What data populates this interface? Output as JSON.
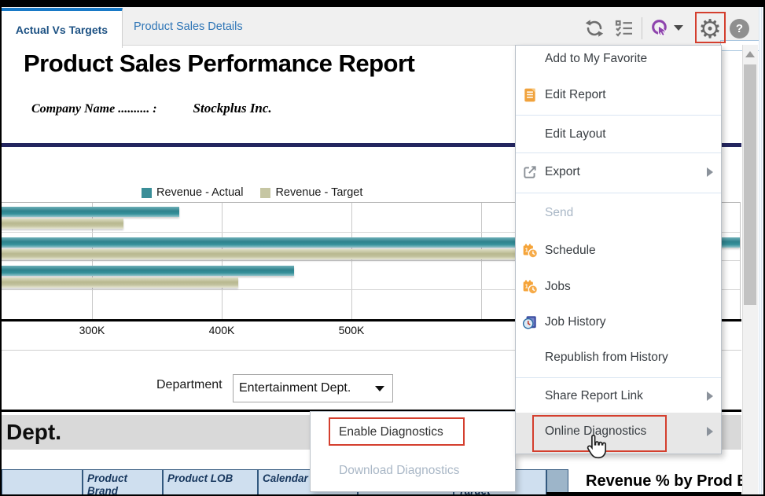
{
  "window": {
    "tabs": [
      {
        "label": "Actual Vs Targets",
        "active": true
      },
      {
        "label": "Product Sales Details",
        "active": false
      }
    ],
    "toolbar": {
      "icons": [
        "refresh-icon",
        "checklist-icon",
        "guided-nav-icon",
        "dropdown-caret-icon",
        "gear-icon",
        "help-icon"
      ],
      "help_glyph": "?"
    }
  },
  "report": {
    "title": "Product Sales Performance Report",
    "company_label": "Company Name .......... :",
    "company_value": "Stockplus Inc."
  },
  "chart_data": {
    "type": "bar",
    "orientation": "horizontal",
    "title": "",
    "xlabel": "",
    "ylabel": "",
    "legend_position": "top",
    "grid": true,
    "legend": [
      {
        "name": "Revenue - Actual",
        "color": "#3a8e98"
      },
      {
        "name": "Revenue - Target",
        "color": "#c6c6a3"
      }
    ],
    "categories": [
      "",
      "",
      ""
    ],
    "series": [
      {
        "name": "Revenue - Actual",
        "values_k": [
          367,
          800,
          456
        ]
      },
      {
        "name": "Revenue - Target",
        "values_k": [
          324,
          757,
          413
        ]
      }
    ],
    "x_ticks": [
      {
        "label": "300K",
        "value_k": 300
      },
      {
        "label": "400K",
        "value_k": 400
      },
      {
        "label": "500K",
        "value_k": 500
      },
      {
        "label": "",
        "value_k": 600
      }
    ],
    "xlim_k": [
      229,
      800
    ]
  },
  "filters": {
    "department_label": "Department",
    "department_value": "Entertainment Dept."
  },
  "menu": {
    "items": [
      {
        "label": "Add to My Favorite"
      },
      {
        "label": "Edit Report",
        "icon": "edit-report-icon"
      },
      {
        "sep": true
      },
      {
        "label": "Edit Layout"
      },
      {
        "sep": true
      },
      {
        "label": "Export",
        "icon": "export-icon",
        "submenu": true
      },
      {
        "sep": true
      },
      {
        "label": "Send",
        "disabled": true
      },
      {
        "label": "Schedule",
        "icon": "schedule-icon"
      },
      {
        "label": "Jobs",
        "icon": "jobs-icon"
      },
      {
        "label": "Job History",
        "icon": "job-history-icon"
      },
      {
        "label": "Republish from History"
      },
      {
        "sep": true
      },
      {
        "label": "Share Report Link",
        "submenu": true
      },
      {
        "label": "Online Diagnostics",
        "submenu": true,
        "highlighted": true
      }
    ]
  },
  "submenu": {
    "items": [
      {
        "label": "Enable Diagnostics"
      },
      {
        "label": "Download Diagnostics",
        "disabled": true
      }
    ]
  },
  "section": {
    "dept_header": "Dept."
  },
  "table": {
    "headers": [
      "",
      "Product Brand",
      "Product LOB",
      "Calendar Qtr",
      "",
      "Revenue - Target"
    ]
  },
  "right_panel": {
    "title": "Revenue % by Prod Br"
  },
  "colors": {
    "accent_tab": "#1879c6",
    "bar_actual": "#3a8e98",
    "bar_target": "#c6c6a3",
    "navy_divider": "#23255f",
    "annotation_red": "#d43f2e",
    "table_header_bg": "#cfdfef",
    "dept_band_bg": "#d9d9d9"
  }
}
